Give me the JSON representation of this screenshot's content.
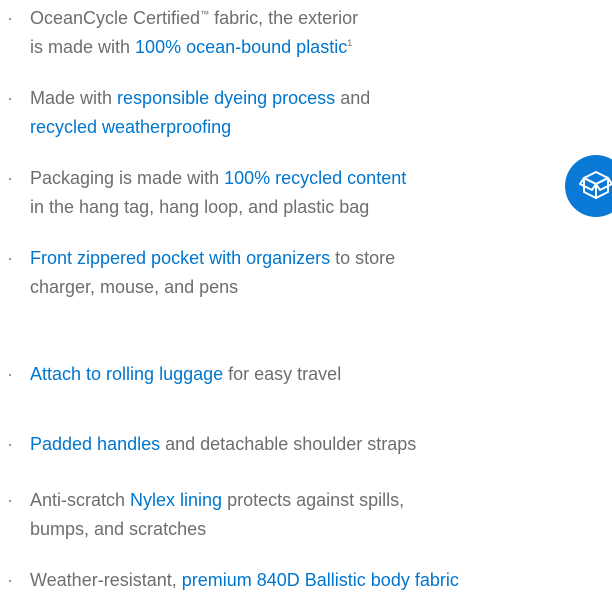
{
  "bullet_char": "·",
  "items": [
    {
      "parts": [
        {
          "t": "OceanCycle Certified",
          "hl": false
        },
        {
          "t": "™",
          "hl": false,
          "sup": true
        },
        {
          "t": " fabric, the exterior",
          "hl": false
        },
        {
          "br": true
        },
        {
          "t": "is made with ",
          "hl": false
        },
        {
          "t": "100% ocean-bound plastic",
          "hl": true
        },
        {
          "t": "1",
          "hl": false,
          "sup": true
        }
      ]
    },
    {
      "parts": [
        {
          "t": "Made with ",
          "hl": false
        },
        {
          "t": "responsible dyeing process",
          "hl": true
        },
        {
          "t": " and",
          "hl": false
        },
        {
          "br": true
        },
        {
          "t": "recycled weatherproofing",
          "hl": true
        }
      ]
    },
    {
      "parts": [
        {
          "t": "Packaging is made with ",
          "hl": false
        },
        {
          "t": "100% recycled content",
          "hl": true
        },
        {
          "br": true
        },
        {
          "t": "in the hang tag, hang loop, and plastic bag",
          "hl": false
        }
      ]
    },
    {
      "parts": [
        {
          "t": "Front zippered pocket with organizers",
          "hl": true
        },
        {
          "t": " to store",
          "hl": false
        },
        {
          "br": true
        },
        {
          "t": "charger, mouse, and pens",
          "hl": false
        }
      ]
    },
    {
      "parts": [
        {
          "t": "Attach to rolling luggage",
          "hl": true
        },
        {
          "t": " for easy travel",
          "hl": false
        }
      ]
    },
    {
      "parts": [
        {
          "t": "Padded handles",
          "hl": true
        },
        {
          "t": " and detachable shoulder straps",
          "hl": false
        }
      ]
    },
    {
      "parts": [
        {
          "t": "Anti-scratch ",
          "hl": false
        },
        {
          "t": "Nylex lining",
          "hl": true
        },
        {
          "t": " protects against spills,",
          "hl": false
        },
        {
          "br": true
        },
        {
          "t": "bumps, and scratches",
          "hl": false
        }
      ]
    },
    {
      "parts": [
        {
          "t": "Weather-resistant, ",
          "hl": false
        },
        {
          "t": "premium 840D Ballistic body fabric",
          "hl": true
        }
      ]
    }
  ],
  "icon": {
    "name": "recycle-box-icon"
  },
  "colors": {
    "text": "#6e6e6e",
    "highlight": "#0076ce",
    "badge": "#0a7ad6"
  }
}
